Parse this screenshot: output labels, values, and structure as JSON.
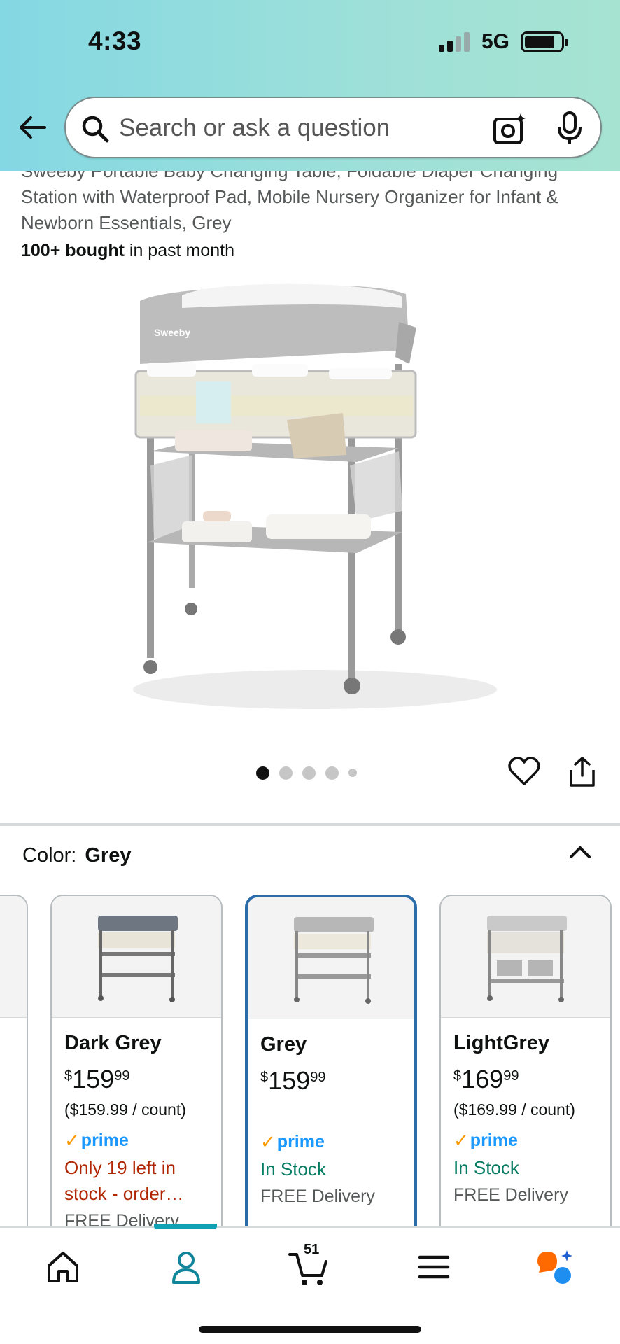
{
  "status_bar": {
    "time": "4:33",
    "network": "5G"
  },
  "search": {
    "placeholder": "Search or ask a question"
  },
  "product": {
    "title": "Sweeby Portable Baby Changing Table, Foldable Diaper Changing Station with Waterproof Pad, Mobile Nursery Organizer for Infant & Newborn Essentials, Grey",
    "bought_bold": "100+ bought",
    "bought_rest": " in past month",
    "brand_logo": "Sweeby",
    "image_count": 5,
    "active_image": 1
  },
  "color": {
    "label": "Color:",
    "value": "Grey"
  },
  "variants": [
    {
      "name": "Dark Grey",
      "price_symbol": "$",
      "price_whole": "159",
      "price_cents": "99",
      "unit_price": "($159.99 / count)",
      "prime": "prime",
      "stock": "Only 19 left in stock - order…",
      "stock_status": "low",
      "delivery": "FREE Delivery",
      "selected": false
    },
    {
      "name": "Grey",
      "price_symbol": "$",
      "price_whole": "159",
      "price_cents": "99",
      "unit_price": "",
      "prime": "prime",
      "stock": "In Stock",
      "stock_status": "in",
      "delivery": "FREE Delivery",
      "selected": true
    },
    {
      "name": "LightGrey",
      "price_symbol": "$",
      "price_whole": "169",
      "price_cents": "99",
      "unit_price": "($169.99 / count)",
      "prime": "prime",
      "stock": "In Stock",
      "stock_status": "in",
      "delivery": "FREE Delivery",
      "selected": false
    }
  ],
  "bottom_nav": {
    "items": [
      "home-icon",
      "account-icon",
      "cart-icon",
      "menu-icon",
      "rufus-icon"
    ],
    "active": "account-icon",
    "cart_count": "51"
  },
  "colors": {
    "prime_blue": "#1a98ff",
    "prime_check": "#ff9900",
    "in_stock": "#067d62",
    "low_stock": "#b12704",
    "selected_border": "#2a6ba8",
    "nav_active": "#11a1b5"
  }
}
